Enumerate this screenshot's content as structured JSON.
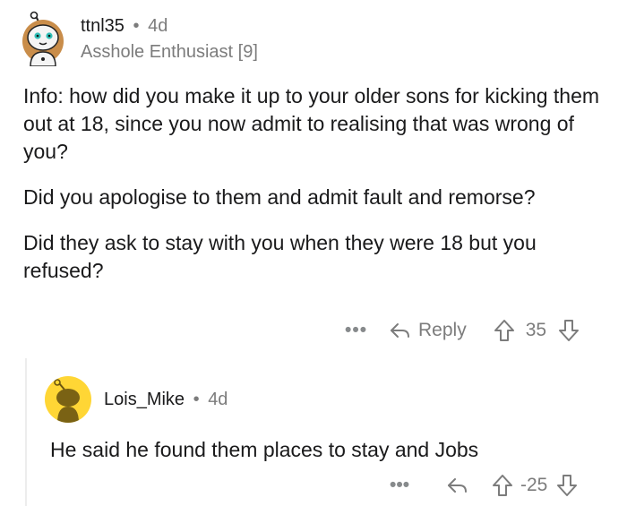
{
  "comment": {
    "username": "ttnl35",
    "separator": "•",
    "time": "4d",
    "flair": "Asshole Enthusiast [9]",
    "paragraphs": [
      "Info: how did you make it up to your older sons for kicking them out at 18, since you now admit to realising that was wrong of you?",
      "Did you apologise to them and admit fault and remorse?",
      "Did they ask to stay with you when they were 18 but you refused?"
    ],
    "actions": {
      "more_label": "•••",
      "reply_label": "Reply",
      "score": "35"
    }
  },
  "reply_comment": {
    "username": "Lois_Mike",
    "separator": "•",
    "time": "4d",
    "text": "He said he found them places to stay and Jobs",
    "actions": {
      "more_label": "•••",
      "score": "-25"
    }
  },
  "colors": {
    "text": "#1a1a1b",
    "muted": "#7c7c7c",
    "reply_avatar_bg": "#ffd635",
    "thread_line": "#ededed"
  },
  "icons": {
    "reply": "reply-arrow-icon",
    "upvote": "upvote-arrow-icon",
    "downvote": "downvote-arrow-icon",
    "more": "more-dots-icon"
  }
}
